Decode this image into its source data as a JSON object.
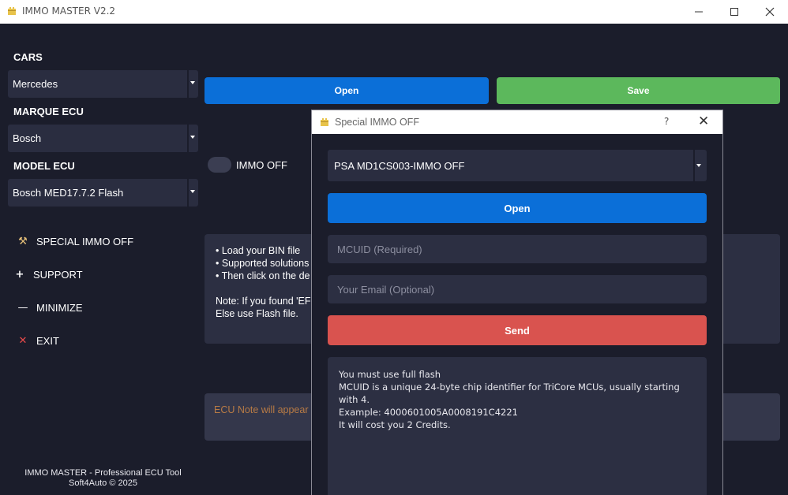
{
  "window": {
    "title": "IMMO MASTER V2.2",
    "controls": {
      "minimize": "—",
      "maximize": "☐",
      "close": "✕"
    }
  },
  "sidebar": {
    "cars_label": "CARS",
    "cars_value": "Mercedes",
    "marque_label": "MARQUE ECU",
    "marque_value": "Bosch",
    "model_label": "MODEL ECU",
    "model_value": "Bosch MED17.7.2 Flash",
    "menu": [
      {
        "label": "SPECIAL IMMO OFF",
        "icon": "tools-icon",
        "glyph": "⚒"
      },
      {
        "label": "SUPPORT",
        "icon": "plus-icon",
        "glyph": "+"
      },
      {
        "label": "MINIMIZE",
        "icon": "minimize-icon",
        "glyph": "—"
      },
      {
        "label": "EXIT",
        "icon": "close-icon",
        "glyph": "✕"
      }
    ],
    "footer_line1": "IMMO MASTER - Professional ECU Tool",
    "footer_line2": "Soft4Auto © 2025"
  },
  "main": {
    "open_label": "Open",
    "save_label": "Save",
    "immo_off_label": "IMMO OFF",
    "immo_off_on": false,
    "info_lines": [
      "• Load your BIN file",
      "• Supported solutions",
      "• Then click on the de",
      "",
      "Note: If you found 'EF",
      "Else use Flash file."
    ],
    "note_placeholder": "ECU Note will appear"
  },
  "dialog": {
    "title": "Special IMMO OFF",
    "help": "?",
    "close": "✕",
    "solution_value": "PSA  MD1CS003-IMMO OFF",
    "open_label": "Open",
    "mcuid_placeholder": "MCUID (Required)",
    "email_placeholder": "Your Email (Optional)",
    "send_label": "Send",
    "info_lines": [
      "You must use full flash",
      "MCUID is a unique 24-byte chip identifier for TriCore MCUs, usually starting with 4.",
      "Example: 4000601005A0008191C4221",
      "It will cost you 2 Credits."
    ]
  },
  "colors": {
    "background": "#1b1d2b",
    "panel": "#2c2f42",
    "open_blue": "#0b6fd8",
    "save_green": "#5cb85c",
    "send_red": "#d9534f",
    "note_orange": "#b87b45",
    "exit_red": "#e84a4a"
  }
}
